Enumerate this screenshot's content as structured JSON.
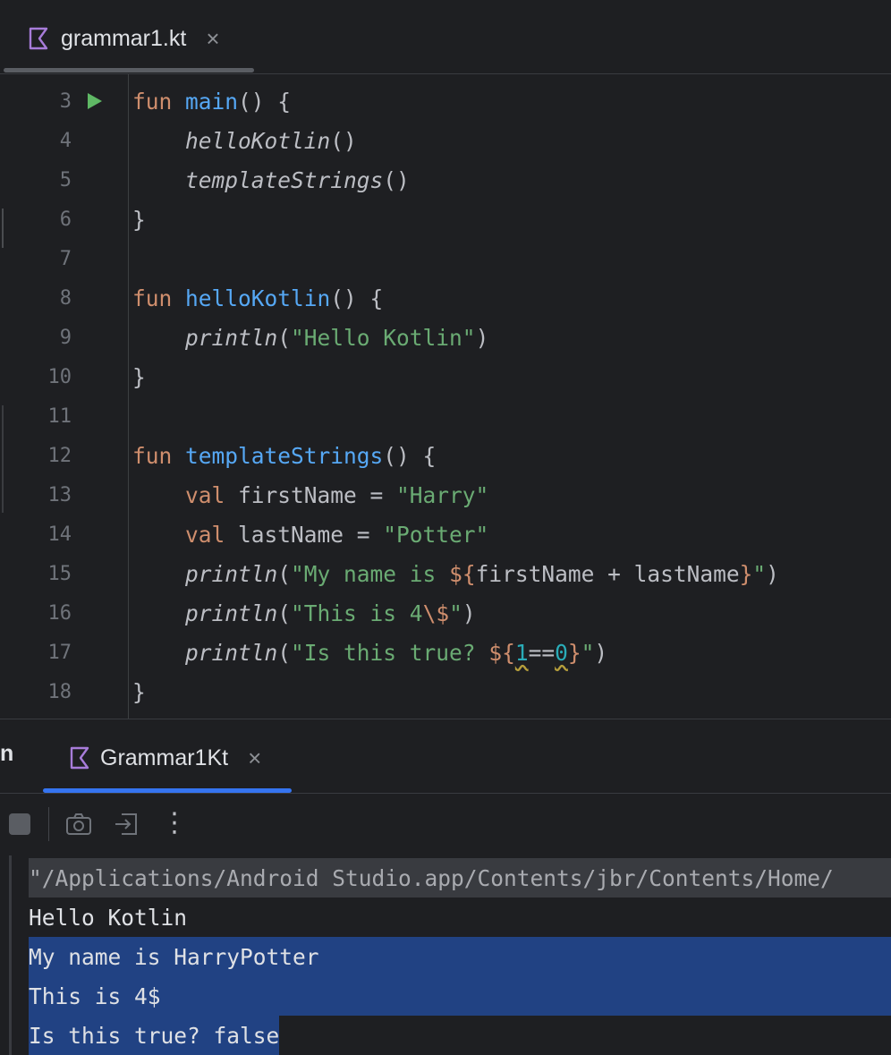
{
  "editor_tab": {
    "filename": "grammar1.kt",
    "close": "×"
  },
  "code": {
    "lines": [
      {
        "n": "3",
        "tokens": [
          [
            "kw",
            "fun "
          ],
          [
            "fn",
            "main"
          ],
          [
            "p",
            "() {"
          ]
        ],
        "run": true
      },
      {
        "n": "4",
        "tokens": [
          [
            "p",
            "    "
          ],
          [
            "call",
            "helloKotlin"
          ],
          [
            "p",
            "()"
          ]
        ]
      },
      {
        "n": "5",
        "tokens": [
          [
            "p",
            "    "
          ],
          [
            "call",
            "templateStrings"
          ],
          [
            "p",
            "()"
          ]
        ]
      },
      {
        "n": "6",
        "tokens": [
          [
            "p",
            "}"
          ]
        ]
      },
      {
        "n": "7",
        "tokens": []
      },
      {
        "n": "8",
        "tokens": [
          [
            "kw",
            "fun "
          ],
          [
            "fn",
            "helloKotlin"
          ],
          [
            "p",
            "() {"
          ]
        ]
      },
      {
        "n": "9",
        "tokens": [
          [
            "p",
            "    "
          ],
          [
            "call",
            "println"
          ],
          [
            "p",
            "("
          ],
          [
            "str",
            "\"Hello Kotlin\""
          ],
          [
            "p",
            ")"
          ]
        ]
      },
      {
        "n": "10",
        "tokens": [
          [
            "p",
            "}"
          ]
        ]
      },
      {
        "n": "11",
        "tokens": []
      },
      {
        "n": "12",
        "tokens": [
          [
            "kw",
            "fun "
          ],
          [
            "fn",
            "templateStrings"
          ],
          [
            "p",
            "() {"
          ]
        ]
      },
      {
        "n": "13",
        "tokens": [
          [
            "p",
            "    "
          ],
          [
            "kw",
            "val "
          ],
          [
            "p",
            "firstName = "
          ],
          [
            "str",
            "\"Harry\""
          ]
        ]
      },
      {
        "n": "14",
        "tokens": [
          [
            "p",
            "    "
          ],
          [
            "kw",
            "val "
          ],
          [
            "p",
            "lastName = "
          ],
          [
            "str",
            "\"Potter\""
          ]
        ]
      },
      {
        "n": "15",
        "tokens": [
          [
            "p",
            "    "
          ],
          [
            "call",
            "println"
          ],
          [
            "p",
            "("
          ],
          [
            "str",
            "\"My name is "
          ],
          [
            "tpl",
            "${"
          ],
          [
            "p",
            "firstName + lastName"
          ],
          [
            "tpl",
            "}"
          ],
          [
            "str",
            "\""
          ],
          [
            "p",
            ")"
          ]
        ]
      },
      {
        "n": "16",
        "tokens": [
          [
            "p",
            "    "
          ],
          [
            "call",
            "println"
          ],
          [
            "p",
            "("
          ],
          [
            "str",
            "\"This is 4"
          ],
          [
            "tpl",
            "\\$"
          ],
          [
            "str",
            "\""
          ],
          [
            "p",
            ")"
          ]
        ]
      },
      {
        "n": "17",
        "tokens": [
          [
            "p",
            "    "
          ],
          [
            "call",
            "println"
          ],
          [
            "p",
            "("
          ],
          [
            "str",
            "\"Is this true? "
          ],
          [
            "tpl",
            "${"
          ],
          [
            "num",
            "1"
          ],
          [
            "p",
            "=="
          ],
          [
            "num",
            "0"
          ],
          [
            "tpl",
            "}"
          ],
          [
            "str",
            "\""
          ],
          [
            "p",
            ")"
          ]
        ]
      },
      {
        "n": "18",
        "tokens": [
          [
            "p",
            "}"
          ]
        ]
      }
    ]
  },
  "run_panel": {
    "cut_label": "n",
    "tab_label": "Grammar1Kt",
    "close": "×",
    "toolbar": {
      "icons": [
        "stop-icon",
        "camera-icon",
        "exit-icon",
        "more-icon"
      ],
      "more": "⋮"
    }
  },
  "console": {
    "command": "\"/Applications/Android Studio.app/Contents/jbr/Contents/Home/",
    "outputs": [
      "Hello Kotlin",
      "My name is HarryPotter",
      "This is 4$",
      "Is this true? false"
    ]
  },
  "colors": {
    "accent": "#3574f0",
    "selection": "#214283",
    "keyword": "#cf8e6d",
    "function": "#56a8f5",
    "string": "#6aab73",
    "number": "#2aacb8"
  }
}
